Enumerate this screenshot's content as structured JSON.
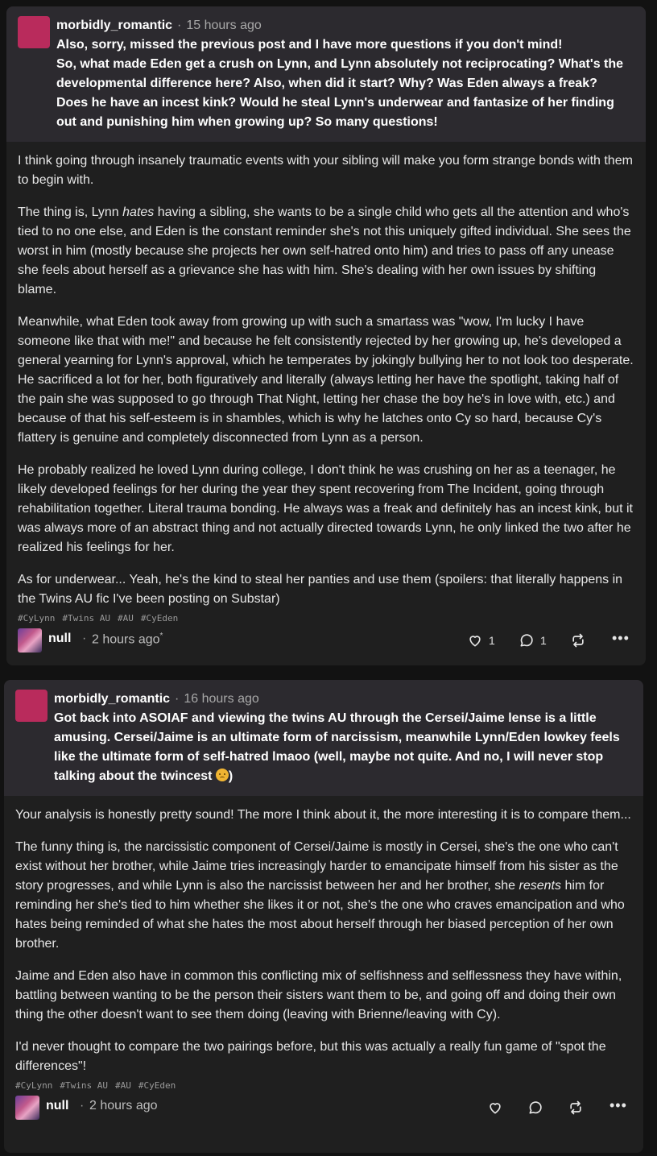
{
  "posts": [
    {
      "ask_user": "morbidly_romantic",
      "separator": "·",
      "ask_time": "15 hours ago",
      "ask_lines": [
        "Also, sorry, missed the previous post and I have more questions if you don't mind!",
        "So, what made Eden get a crush on Lynn, and Lynn absolutely not reciprocating? What's the developmental difference here? Also, when did it start? Why? Was Eden always a freak? Does he have an incest kink? Would he steal Lynn's underwear and fantasize of her finding out and punishing him when growing up? So many questions!"
      ],
      "answer_paragraphs": [
        "I think going through insanely traumatic events with your sibling will make you form strange bonds with them to begin with.",
        "The thing is, Lynn hates having a sibling, she wants to be a single child who gets all the attention and who's tied to no one else, and Eden is the constant reminder she's not this uniquely gifted individual. She sees the worst in him (mostly because she projects her own self-hatred onto him) and tries to pass off any unease she feels about herself as a grievance she has with him. She's dealing with her own issues by shifting blame.",
        "Meanwhile, what Eden took away from growing up with such a smartass was \"wow, I'm lucky I have someone like that with me!\" and because he felt consistently rejected by her growing up, he's developed a general yearning for Lynn's approval, which he temperates by jokingly bullying her to not look too desperate. He sacrificed a lot for her, both figuratively and literally (always letting her have the spotlight, taking half of the pain she was supposed to go through That Night, letting her chase the boy he's in love with, etc.) and because of that his self-esteem is in shambles, which is why he latches onto Cy so hard, because Cy's flattery is genuine and completely disconnected from Lynn as a person.",
        "He probably realized he loved Lynn during college, I don't think he was crushing on her as a teenager, he likely developed feelings for her during the year they spent recovering from The Incident, going through rehabilitation together. Literal trauma bonding. He always was a freak and definitely has an incest kink, but it was always more of an abstract thing and not actually directed towards Lynn, he only linked the two after he realized his feelings for her.",
        "As for underwear... Yeah, he's the kind to steal her panties and use them (spoilers: that literally happens in the Twins AU fic I've been posting on Substar)"
      ],
      "tags": [
        "#CyLynn",
        "#Twins AU",
        "#AU",
        "#CyEden"
      ],
      "reply_user": "null",
      "reply_time": "2 hours ago",
      "reply_edited_mark": "*",
      "likes": "1",
      "comments": "1"
    },
    {
      "ask_user": "morbidly_romantic",
      "separator": "·",
      "ask_time": "16 hours ago",
      "ask_text": "Got back into ASOIAF and viewing the twins AU through the Cersei/Jaime lense is a little amusing. Cersei/Jaime is an ultimate form of narcissism, meanwhile Lynn/Eden lowkey feels like the ultimate form of self-hatred lmaoo (well, maybe not quite. And no, I will never stop talking about the twincest",
      "ask_close": ")",
      "emoji": "disappointed-face",
      "answer_paragraphs": [
        "Your analysis is honestly pretty sound! The more I think about it, the more interesting it is to compare them...",
        "The funny thing is, the narcissistic component of Cersei/Jaime is mostly in Cersei, she's the one who can't exist without her brother, while Jaime tries increasingly harder to emancipate himself from his sister as the story progresses, and while Lynn is also the narcissist between her and her brother, she resents him for reminding her she's tied to him whether she likes it or not, she's the one who craves emancipation and who hates being reminded of what she hates the most about herself through her biased perception of her own brother.",
        "Jaime and Eden also have in common this conflicting mix of selfishness and selflessness they have within, battling between wanting to be the person their sisters want them to be, and going off and doing their own thing the other doesn't want to see them doing (leaving with Brienne/leaving with Cy).",
        "I'd never thought to compare the two pairings before, but this was actually a really fun game of \"spot the differences\"!"
      ],
      "tags": [
        "#CyLynn",
        "#Twins AU",
        "#AU",
        "#CyEden"
      ],
      "reply_user": "null",
      "reply_time": "2 hours ago"
    }
  ],
  "more_label": "•••"
}
